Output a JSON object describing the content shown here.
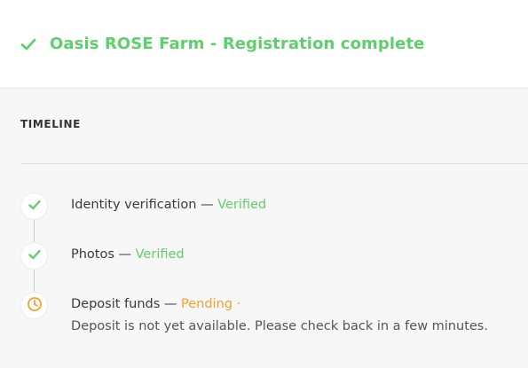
{
  "header": {
    "title": "Oasis ROSE Farm - Registration complete",
    "icon": "check-icon",
    "color": "#5fcf6b"
  },
  "timeline": {
    "heading": "TIMELINE",
    "separator": "—",
    "items": [
      {
        "label": "Identity verification",
        "status": "Verified",
        "state": "verified",
        "icon": "check-icon"
      },
      {
        "label": "Photos",
        "status": "Verified",
        "state": "verified",
        "icon": "check-icon"
      },
      {
        "label": "Deposit funds",
        "status": "Pending ·",
        "state": "pending",
        "icon": "clock-icon",
        "detail": "Deposit is not yet available. Please check back in a few minutes."
      }
    ]
  },
  "colors": {
    "verified": "#5fcf6b",
    "pending": "#f5a02f"
  }
}
